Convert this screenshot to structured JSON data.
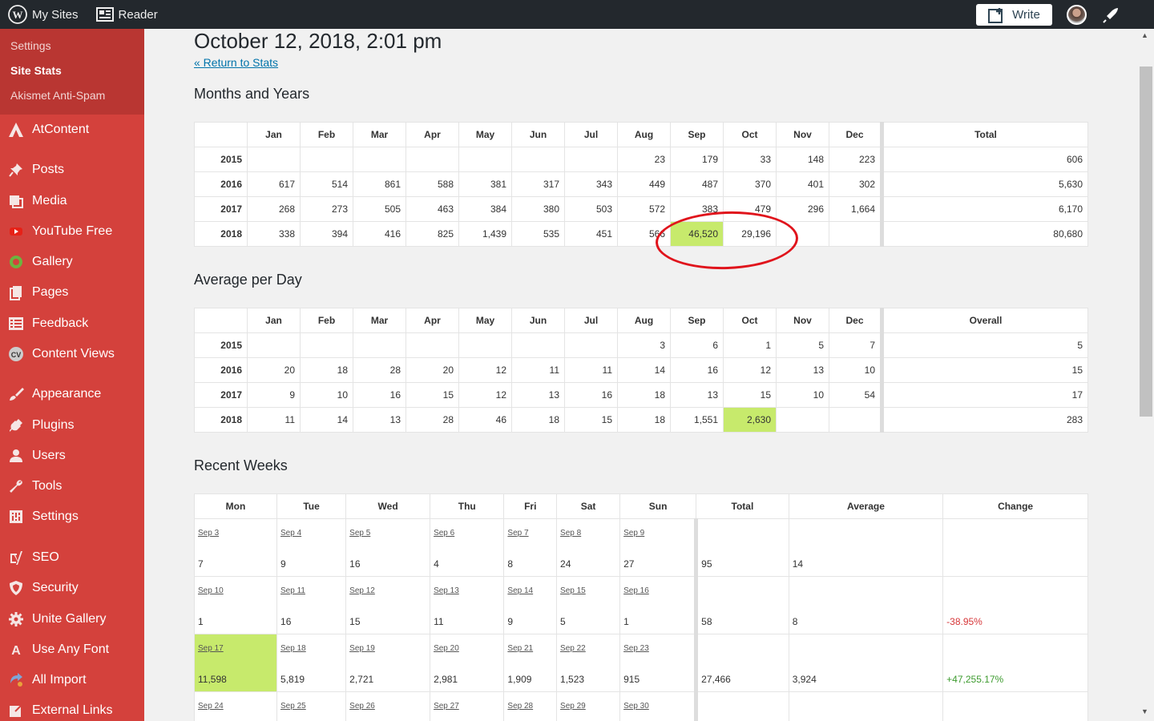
{
  "topbar": {
    "my_sites": "My Sites",
    "reader": "Reader",
    "write": "Write"
  },
  "sidebar": {
    "submenu": [
      "Settings",
      "Site Stats",
      "Akismet Anti-Spam"
    ],
    "items": [
      {
        "label": "AtContent",
        "icon": "atcontent-icon"
      },
      {
        "label": "Posts",
        "icon": "pushpin-icon"
      },
      {
        "label": "Media",
        "icon": "media-icon"
      },
      {
        "label": "YouTube Free",
        "icon": "youtube-icon"
      },
      {
        "label": "Gallery",
        "icon": "gallery-icon"
      },
      {
        "label": "Pages",
        "icon": "pages-icon"
      },
      {
        "label": "Feedback",
        "icon": "feedback-icon"
      },
      {
        "label": "Content Views",
        "icon": "cv-icon"
      },
      {
        "label": "Appearance",
        "icon": "brush-icon"
      },
      {
        "label": "Plugins",
        "icon": "plugin-icon"
      },
      {
        "label": "Users",
        "icon": "user-icon"
      },
      {
        "label": "Tools",
        "icon": "wrench-icon"
      },
      {
        "label": "Settings",
        "icon": "settings-icon"
      },
      {
        "label": "SEO",
        "icon": "yoast-icon"
      },
      {
        "label": "Security",
        "icon": "shield-icon"
      },
      {
        "label": "Unite Gallery",
        "icon": "gear-icon"
      },
      {
        "label": "Use Any Font",
        "icon": "font-icon"
      },
      {
        "label": "All Import",
        "icon": "import-icon"
      },
      {
        "label": "External Links",
        "icon": "external-link-icon"
      }
    ]
  },
  "main": {
    "date": "October 12, 2018, 2:01 pm",
    "return_link": "« Return to Stats",
    "months_title": "Months and Years",
    "avg_title": "Average per Day",
    "weeks_title": "Recent Weeks"
  },
  "months_header": [
    "Jan",
    "Feb",
    "Mar",
    "Apr",
    "May",
    "Jun",
    "Jul",
    "Aug",
    "Sep",
    "Oct",
    "Nov",
    "Dec"
  ],
  "months_total_label": "Total",
  "months_rows": [
    {
      "year": "2015",
      "values": [
        "",
        "",
        "",
        "",
        "",
        "",
        "",
        "23",
        "179",
        "33",
        "148",
        "223"
      ],
      "total": "606"
    },
    {
      "year": "2016",
      "values": [
        "617",
        "514",
        "861",
        "588",
        "381",
        "317",
        "343",
        "449",
        "487",
        "370",
        "401",
        "302"
      ],
      "total": "5,630"
    },
    {
      "year": "2017",
      "values": [
        "268",
        "273",
        "505",
        "463",
        "384",
        "380",
        "503",
        "572",
        "383",
        "479",
        "296",
        "1,664"
      ],
      "total": "6,170"
    },
    {
      "year": "2018",
      "values": [
        "338",
        "394",
        "416",
        "825",
        "1,439",
        "535",
        "451",
        "566",
        "46,520",
        "29,196",
        "",
        ""
      ],
      "total": "80,680"
    }
  ],
  "avg_total_label": "Overall",
  "avg_rows": [
    {
      "year": "2015",
      "values": [
        "",
        "",
        "",
        "",
        "",
        "",
        "",
        "3",
        "6",
        "1",
        "5",
        "7"
      ],
      "total": "5"
    },
    {
      "year": "2016",
      "values": [
        "20",
        "18",
        "28",
        "20",
        "12",
        "11",
        "11",
        "14",
        "16",
        "12",
        "13",
        "10"
      ],
      "total": "15"
    },
    {
      "year": "2017",
      "values": [
        "9",
        "10",
        "16",
        "15",
        "12",
        "13",
        "16",
        "18",
        "13",
        "15",
        "10",
        "54"
      ],
      "total": "17"
    },
    {
      "year": "2018",
      "values": [
        "11",
        "14",
        "13",
        "28",
        "46",
        "18",
        "15",
        "18",
        "1,551",
        "2,630",
        "",
        ""
      ],
      "total": "283"
    }
  ],
  "weeks_header": [
    "Mon",
    "Tue",
    "Wed",
    "Thu",
    "Fri",
    "Sat",
    "Sun",
    "Total",
    "Average",
    "Change"
  ],
  "weeks": [
    {
      "days": [
        {
          "d": "Sep 3",
          "v": "7"
        },
        {
          "d": "Sep 4",
          "v": "9"
        },
        {
          "d": "Sep 5",
          "v": "16"
        },
        {
          "d": "Sep 6",
          "v": "4"
        },
        {
          "d": "Sep 7",
          "v": "8"
        },
        {
          "d": "Sep 8",
          "v": "24"
        },
        {
          "d": "Sep 9",
          "v": "27"
        }
      ],
      "total": "95",
      "average": "14",
      "change": ""
    },
    {
      "days": [
        {
          "d": "Sep 10",
          "v": "1"
        },
        {
          "d": "Sep 11",
          "v": "16"
        },
        {
          "d": "Sep 12",
          "v": "15"
        },
        {
          "d": "Sep 13",
          "v": "11"
        },
        {
          "d": "Sep 14",
          "v": "9"
        },
        {
          "d": "Sep 15",
          "v": "5"
        },
        {
          "d": "Sep 16",
          "v": "1"
        }
      ],
      "total": "58",
      "average": "8",
      "change": "-38.95%"
    },
    {
      "days": [
        {
          "d": "Sep 17",
          "v": "11,598"
        },
        {
          "d": "Sep 18",
          "v": "5,819"
        },
        {
          "d": "Sep 19",
          "v": "2,721"
        },
        {
          "d": "Sep 20",
          "v": "2,981"
        },
        {
          "d": "Sep 21",
          "v": "1,909"
        },
        {
          "d": "Sep 22",
          "v": "1,523"
        },
        {
          "d": "Sep 23",
          "v": "915"
        }
      ],
      "total": "27,466",
      "average": "3,924",
      "change": "+47,255.17%"
    },
    {
      "days": [
        {
          "d": "Sep 24",
          "v": ""
        },
        {
          "d": "Sep 25",
          "v": ""
        },
        {
          "d": "Sep 26",
          "v": ""
        },
        {
          "d": "Sep 27",
          "v": ""
        },
        {
          "d": "Sep 28",
          "v": ""
        },
        {
          "d": "Sep 29",
          "v": ""
        },
        {
          "d": "Sep 30",
          "v": ""
        }
      ],
      "total": "",
      "average": "",
      "change": ""
    }
  ],
  "colors": {
    "sidebar": "#d4413c",
    "submenu": "#b93632",
    "highlight": "#c7ea6c",
    "annotation_circle": "#e0141c"
  }
}
